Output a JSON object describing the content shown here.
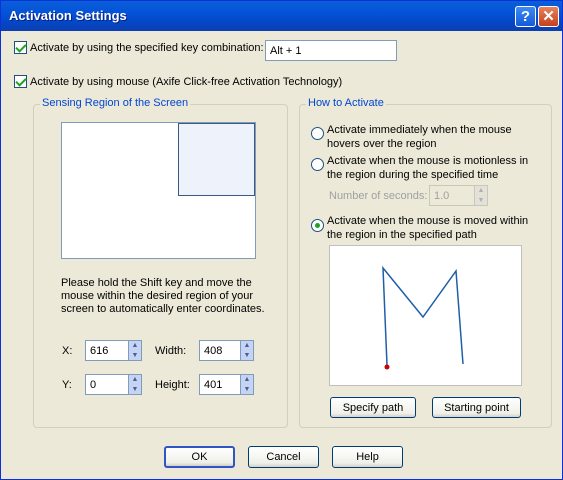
{
  "window": {
    "title": "Activation Settings",
    "help_symbol": "?",
    "close_symbol": "✕"
  },
  "key_combo": {
    "label": "Activate by using the specified key combination:",
    "value": "Alt + 1",
    "checked": true
  },
  "mouse": {
    "label": "Activate by using mouse (Axife Click-free Activation Technology)",
    "checked": true
  },
  "sensing": {
    "title": "Sensing Region of the Screen",
    "instructions": "Please hold the Shift key and move the mouse within the desired region of your screen to automatically enter coordinates.",
    "x_label": "X:",
    "x_value": "616",
    "width_label": "Width:",
    "width_value": "408",
    "y_label": "Y:",
    "y_value": "0",
    "height_label": "Height:",
    "height_value": "401"
  },
  "how": {
    "title": "How to Activate",
    "option1": "Activate immediately when the mouse hovers over the region",
    "option2": "Activate when the mouse is motionless in the region during the specified time",
    "seconds_label": "Number of seconds:",
    "seconds_value": "1.0",
    "option3": "Activate when the mouse is moved within the region in the specified path",
    "selected_option": 3,
    "specify_path": "Specify path",
    "starting_point": "Starting point"
  },
  "footer": {
    "ok": "OK",
    "cancel": "Cancel",
    "help": "Help"
  },
  "colors": {
    "title_bar": "#0453d9",
    "group_title": "#0046d5",
    "check": "#21a121",
    "path_line": "#1f5fa8",
    "path_start": "#cc0000"
  }
}
